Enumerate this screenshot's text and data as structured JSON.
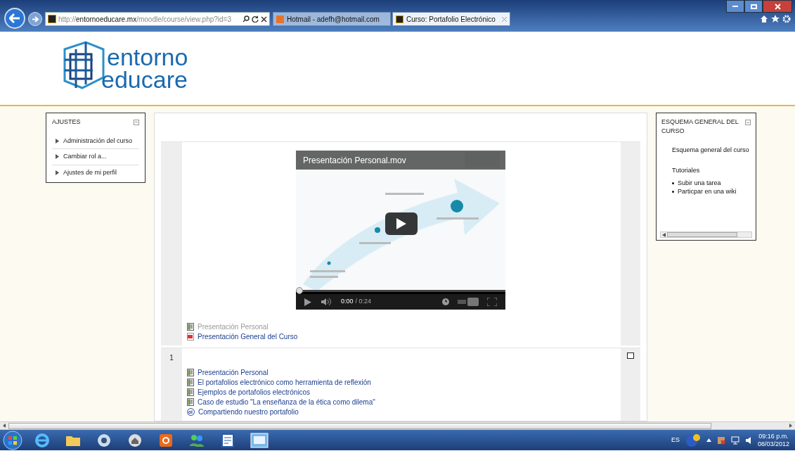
{
  "browser": {
    "address": {
      "prefix": "http://",
      "domain": "entornoeducare.mx",
      "path": "/moodle/course/view.php?id=3"
    },
    "tabs": [
      {
        "label": "Hotmail - adefh@hotmail.com",
        "selected": false
      },
      {
        "label": "Curso: Portafolio Electrónico",
        "selected": true
      }
    ]
  },
  "logo": {
    "line1": "entorno",
    "line2": "educare"
  },
  "settings_block": {
    "title": "AJUSTES",
    "items": [
      "Administración del curso",
      "Cambiar rol a...",
      "Ajustes de mi perfil"
    ]
  },
  "outline_block": {
    "title": "ESQUEMA GENERAL DEL CURSO",
    "link": "Esquema general del curso",
    "heading": "Tutoriales",
    "items": [
      "Subir una tarea",
      "Particpar en una wiki"
    ]
  },
  "sections": [
    {
      "video": {
        "title": "Presentación Personal.mov",
        "time": "0:00",
        "duration": "/ 0:24",
        "level": 0
      },
      "activities": [
        {
          "kind": "page",
          "label": "Presentación Personal",
          "dimmed": true
        },
        {
          "kind": "pdf",
          "label": "Presentación General del Curso",
          "dimmed": false
        }
      ]
    },
    {
      "number": "1",
      "highlighted": false,
      "activities": [
        {
          "kind": "page",
          "label": "Presentación Personal",
          "dimmed": false
        },
        {
          "kind": "page",
          "label": "El portafolios electrónico como herramienta de reflexión",
          "dimmed": false
        },
        {
          "kind": "page",
          "label": "Ejemplos de portafolios electrónicos",
          "dimmed": false
        },
        {
          "kind": "page",
          "label": "Caso de estudio \"La enseñanza de la ética como dilema\"",
          "dimmed": false
        },
        {
          "kind": "wiki",
          "label": "Compartiendo nuestro portafolio",
          "dimmed": false
        }
      ]
    }
  ],
  "taskbar": {
    "language": "ES",
    "time": "09:16 p.m.",
    "date": "08/03/2012"
  }
}
